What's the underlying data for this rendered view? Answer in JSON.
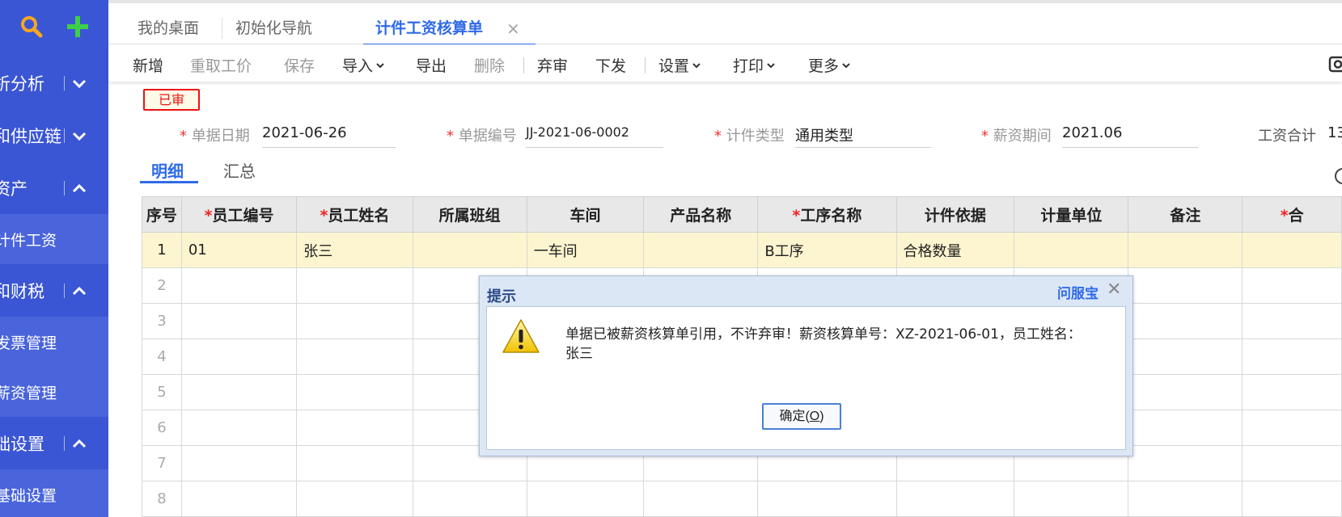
{
  "sidebar": {
    "top_icons": [
      "search-icon",
      "plus-icon"
    ],
    "items": [
      {
        "label": "析分析",
        "chevron": "down"
      },
      {
        "label": "和供应链",
        "chevron": "down"
      },
      {
        "label": "资产",
        "chevron": "up"
      },
      {
        "label": "计件工资",
        "sub": true
      },
      {
        "label": "和财税",
        "chevron": "up"
      },
      {
        "label": "发票管理",
        "sub": true
      },
      {
        "label": "薪资管理",
        "sub": true
      },
      {
        "label": "础设置",
        "chevron": "up"
      },
      {
        "label": "基础设置",
        "sub": true
      }
    ],
    "accent": "#3b56d4"
  },
  "tabs": [
    {
      "label": "我的桌面"
    },
    {
      "label": "初始化导航"
    },
    {
      "label": "计件工资核算单",
      "active": true,
      "closable": true
    }
  ],
  "toolbar": {
    "new": "新增",
    "refetch_price": "重取工价",
    "save": "保存",
    "import": "导入",
    "export": "导出",
    "delete": "删除",
    "unaudit": "弃审",
    "issue": "下发",
    "settings": "设置",
    "print": "打印",
    "more": "更多"
  },
  "status_badge": "已审",
  "form": {
    "doc_date": {
      "label": "单据日期",
      "value": "2021-06-26"
    },
    "doc_no": {
      "label": "单据编号",
      "value": "JJ-2021-06-0002"
    },
    "piece_type": {
      "label": "计件类型",
      "value": "通用类型"
    },
    "pay_period": {
      "label": "薪资期间",
      "value": "2021.06"
    },
    "wage_total": {
      "label": "工资合计",
      "value": "13"
    }
  },
  "detail_tabs": [
    "明细",
    "汇总"
  ],
  "grid": {
    "columns": [
      "序号",
      "员工编号",
      "员工姓名",
      "所属班组",
      "车间",
      "产品名称",
      "工序名称",
      "计件依据",
      "计量单位",
      "备注",
      "合"
    ],
    "required": [
      false,
      true,
      true,
      false,
      false,
      false,
      true,
      false,
      false,
      false,
      true
    ],
    "rows": [
      {
        "no": "1",
        "emp_no": "01",
        "emp_name": "张三",
        "team": "",
        "workshop": "一车间",
        "product": "",
        "process": "B工序",
        "basis": "合格数量",
        "unit": "",
        "remark": "",
        "x": ""
      },
      {
        "no": "2"
      },
      {
        "no": "3"
      },
      {
        "no": "4"
      },
      {
        "no": "5"
      },
      {
        "no": "6"
      },
      {
        "no": "7"
      },
      {
        "no": "8"
      }
    ]
  },
  "dialog": {
    "title": "提示",
    "help_link": "问服宝",
    "message": "单据已被薪资核算单引用，不许弃审！薪资核算单号：XZ-2021-06-01，员工姓名：张三",
    "ok_label": "确定(",
    "ok_key": "O",
    "ok_suffix": ")"
  }
}
